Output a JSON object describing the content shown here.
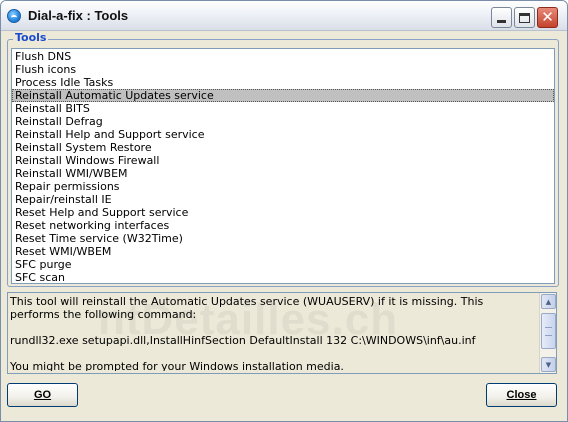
{
  "window": {
    "title": "Dial-a-fix : Tools"
  },
  "titlebar_buttons": {
    "minimize": "minimize",
    "maximize": "maximize",
    "close": "close"
  },
  "tools_group": {
    "label": "Tools",
    "selected_index": 3,
    "items": [
      "Flush DNS",
      "Flush icons",
      "Process Idle Tasks",
      "Reinstall Automatic Updates service",
      "Reinstall BITS",
      "Reinstall Defrag",
      "Reinstall Help and Support service",
      "Reinstall System Restore",
      "Reinstall Windows Firewall",
      "Reinstall WMI/WBEM",
      "Repair permissions",
      "Repair/reinstall IE",
      "Reset Help and Support service",
      "Reset networking interfaces",
      "Reset Time service (W32Time)",
      "Reset WMI/WBEM",
      "SFC purge",
      "SFC scan"
    ]
  },
  "description": {
    "line1": "This tool will reinstall the Automatic Updates service (WUAUSERV) if it is missing.  This",
    "line2": "performs the following command:",
    "line3": "rundll32.exe setupapi.dll,InstallHinfSection DefaultInstall 132 C:\\WINDOWS\\inf\\au.inf",
    "line4": "You might be prompted for your Windows installation media.",
    "watermark": "ntDetailles.ch"
  },
  "buttons": {
    "go": "GO",
    "close": "Close"
  }
}
